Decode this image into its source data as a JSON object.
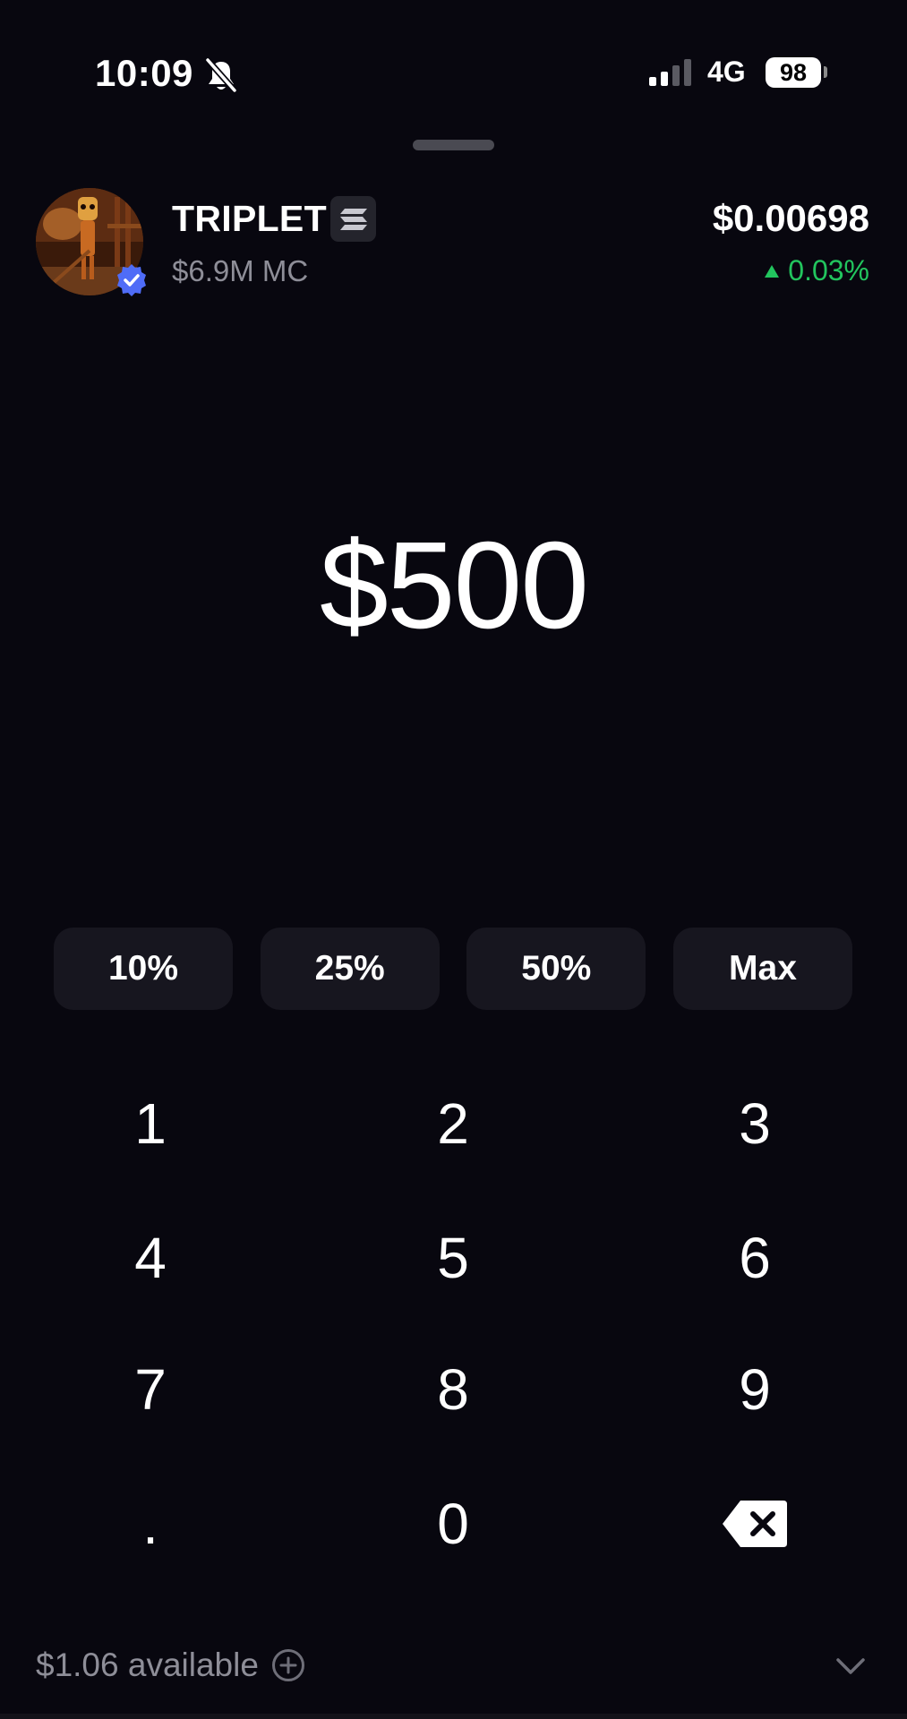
{
  "status_bar": {
    "time": "10:09",
    "network": "4G",
    "battery": "98"
  },
  "token": {
    "name": "TRIPLET",
    "market_cap": "$6.9M MC",
    "price": "$0.00698",
    "change": "0.03%"
  },
  "amount": "$500",
  "quick_amounts": [
    "10%",
    "25%",
    "50%",
    "Max"
  ],
  "keypad": [
    "1",
    "2",
    "3",
    "4",
    "5",
    "6",
    "7",
    "8",
    "9",
    ".",
    "0"
  ],
  "balance": {
    "available": "$1.06 available"
  },
  "colors": {
    "background": "#08070f",
    "button": "#17161f",
    "positive": "#22c55e",
    "muted_text": "#8e8e98",
    "verified": "#4f6cf7"
  },
  "icons": {
    "bell": "bell-slash-icon",
    "chain": "solana-icon",
    "verified": "verified-badge-icon",
    "backspace": "backspace-icon",
    "add": "plus-circle-icon",
    "expand": "chevron-down-icon"
  }
}
